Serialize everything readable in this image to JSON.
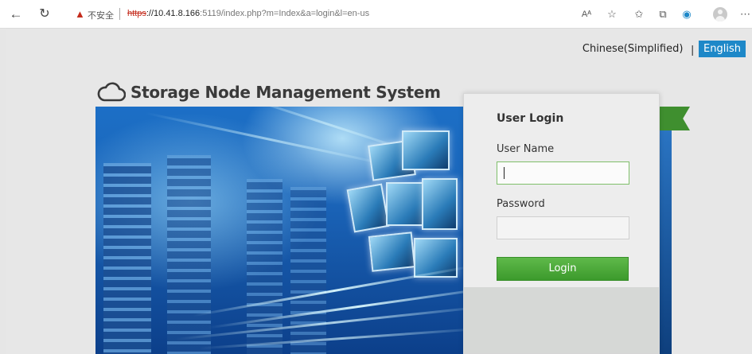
{
  "browser": {
    "security_label": "不安全",
    "url_scheme": "https",
    "url_host": "://10.41.8.166",
    "url_rest": ":5119/index.php?m=Index&a=login&l=en-us",
    "reader_label": "Aᴬ",
    "icons": [
      "back-icon",
      "reload-icon",
      "warning-icon",
      "read-aloud-icon",
      "add-favorite-icon",
      "favorites-icon",
      "collections-icon",
      "edge-icon",
      "profile-icon",
      "more-icon"
    ]
  },
  "lang": {
    "chinese": "Chinese(Simplified)",
    "separator": "|",
    "english": "English",
    "active_color": "#1e88c8"
  },
  "header": {
    "title": "Storage Node Management System"
  },
  "login": {
    "title": "User Login",
    "username_label": "User Name",
    "username_value": "",
    "password_label": "Password",
    "password_value": "",
    "button_label": "Login",
    "button_color": "#4caf3a"
  }
}
